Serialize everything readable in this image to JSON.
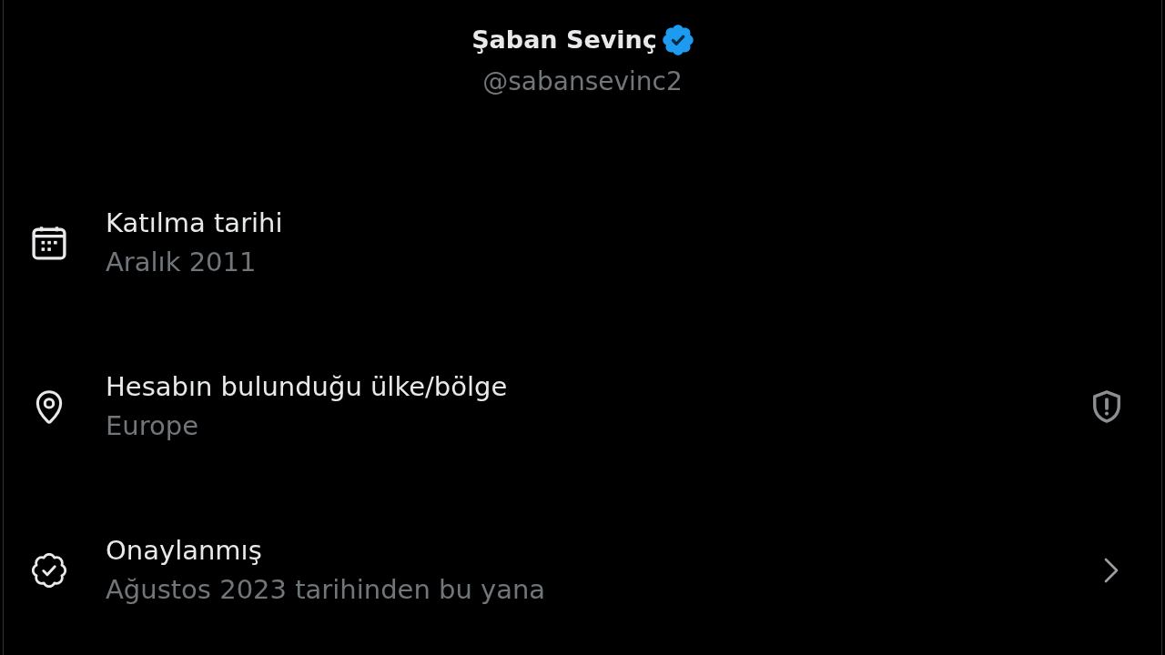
{
  "profile": {
    "name": "Şaban Sevinç",
    "verified": true,
    "handle": "@sabansevinc2"
  },
  "details": [
    {
      "kind": "joined",
      "title": "Katılma tarihi",
      "value": "Aralık 2011"
    },
    {
      "kind": "location",
      "title": "Hesabın bulunduğu ülke/bölge",
      "value": "Europe",
      "action": {
        "kind": "shield"
      }
    },
    {
      "kind": "verified",
      "title": "Onaylanmış",
      "value": "Ağustos 2023 tarihinden bu yana",
      "action": {
        "kind": "chevron"
      }
    }
  ]
}
